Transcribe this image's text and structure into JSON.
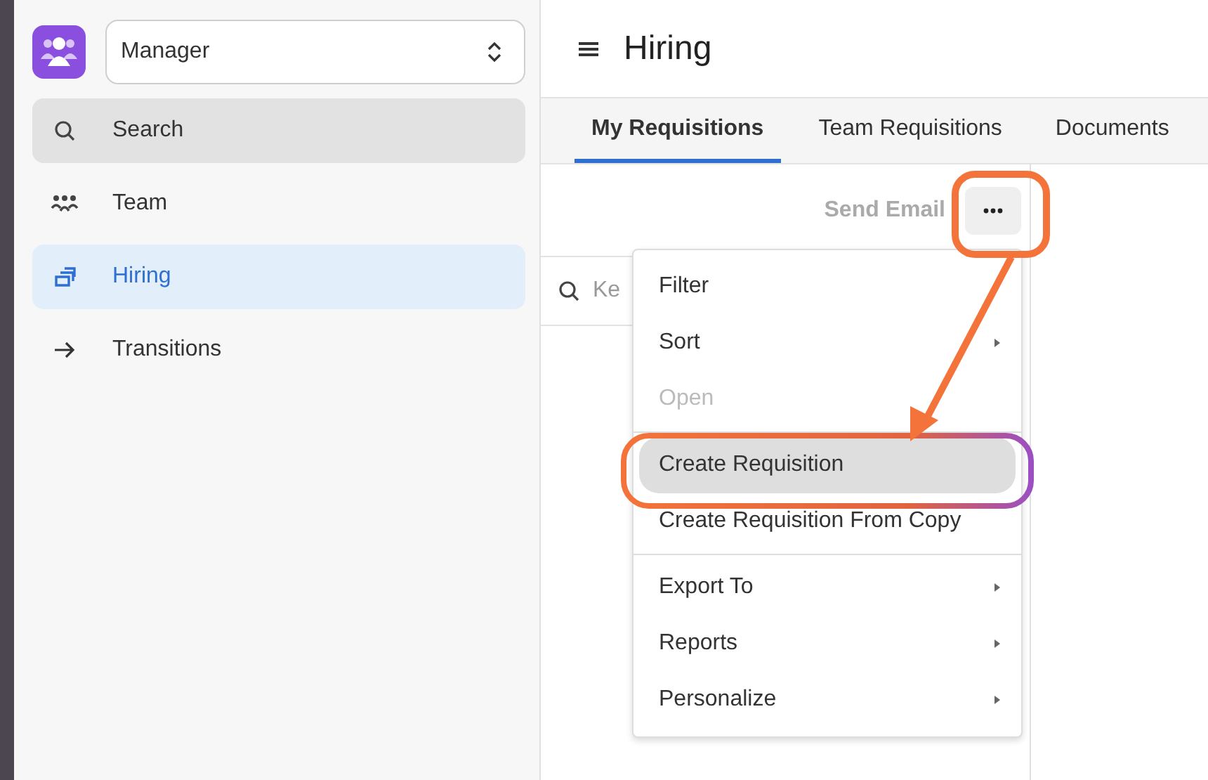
{
  "role_select": {
    "value": "Manager"
  },
  "sidebar": {
    "items": [
      {
        "label": "Search",
        "kind": "search",
        "selected": false
      },
      {
        "label": "Team",
        "kind": "team",
        "selected": false
      },
      {
        "label": "Hiring",
        "kind": "hiring",
        "selected": true
      },
      {
        "label": "Transitions",
        "kind": "arrow",
        "selected": false
      }
    ]
  },
  "header": {
    "title": "Hiring"
  },
  "tabs": [
    {
      "label": "My Requisitions",
      "selected": true
    },
    {
      "label": "Team Requisitions",
      "selected": false
    },
    {
      "label": "Documents",
      "selected": false
    }
  ],
  "toolbar": {
    "send_email": {
      "label": "Send Email",
      "disabled": true
    }
  },
  "search": {
    "placeholder": "Ke"
  },
  "menu": {
    "groups": [
      [
        {
          "label": "Filter",
          "submenu": false,
          "disabled": false,
          "selected": false
        },
        {
          "label": "Sort",
          "submenu": true,
          "disabled": false,
          "selected": false
        },
        {
          "label": "Open",
          "submenu": false,
          "disabled": true,
          "selected": false
        }
      ],
      [
        {
          "label": "Create Requisition",
          "submenu": false,
          "disabled": false,
          "selected": true
        },
        {
          "label": "Create Requisition From Copy",
          "submenu": false,
          "disabled": false,
          "selected": false
        }
      ],
      [
        {
          "label": "Export To",
          "submenu": true,
          "disabled": false,
          "selected": false
        },
        {
          "label": "Reports",
          "submenu": true,
          "disabled": false,
          "selected": false
        },
        {
          "label": "Personalize",
          "submenu": true,
          "disabled": false,
          "selected": false
        }
      ]
    ]
  }
}
